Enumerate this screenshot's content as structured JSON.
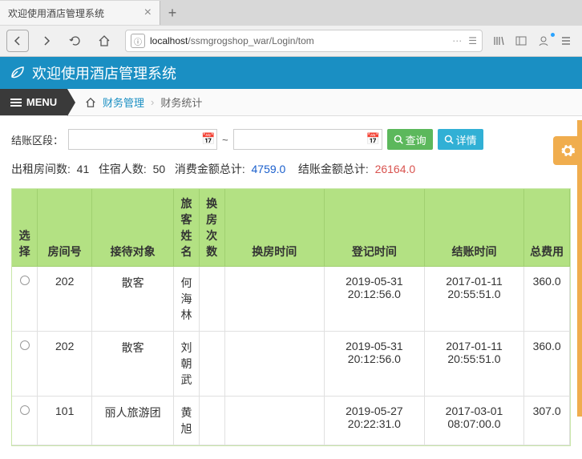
{
  "browser": {
    "tab_title": "欢迎使用酒店管理系统",
    "url_display_prefix": "localhost",
    "url_display_path": "/ssmgrogshop_war/Login/tom"
  },
  "header": {
    "title": "欢迎使用酒店管理系统"
  },
  "menu": {
    "label": "MENU"
  },
  "breadcrumb": {
    "item1": "财务管理",
    "item2": "财务统计"
  },
  "filter": {
    "label": "结账区段：",
    "sep": "~",
    "start_value": "",
    "end_value": "",
    "search_label": "查询",
    "detail_label": "详情"
  },
  "stats": {
    "rooms_label": "出租房间数:",
    "rooms_value": "41",
    "guests_label": "住宿人数:",
    "guests_value": "50",
    "consume_label": "消费金额总计:",
    "consume_value": "4759.0",
    "settle_label": "结账金额总计:",
    "settle_value": "26164.0"
  },
  "table": {
    "headers": {
      "select": "选择",
      "room": "房间号",
      "target": "接待对象",
      "guest": "旅客姓名",
      "swap_count": "换房次数",
      "swap_time": "换房时间",
      "checkin": "登记时间",
      "checkout": "结账时间",
      "total": "总费用"
    },
    "rows": [
      {
        "room": "202",
        "target": "散客",
        "guest": "何海林",
        "swap_count": "",
        "swap_time": "",
        "checkin": "2019-05-31 20:12:56.0",
        "checkout": "2017-01-11 20:55:51.0",
        "total": "360.0"
      },
      {
        "room": "202",
        "target": "散客",
        "guest": "刘朝武",
        "swap_count": "",
        "swap_time": "",
        "checkin": "2019-05-31 20:12:56.0",
        "checkout": "2017-01-11 20:55:51.0",
        "total": "360.0"
      },
      {
        "room": "101",
        "target": "丽人旅游团",
        "guest": "黄旭",
        "swap_count": "",
        "swap_time": "",
        "checkin": "2019-05-27 20:22:31.0",
        "checkout": "2017-03-01 08:07:00.0",
        "total": "307.0"
      }
    ]
  }
}
